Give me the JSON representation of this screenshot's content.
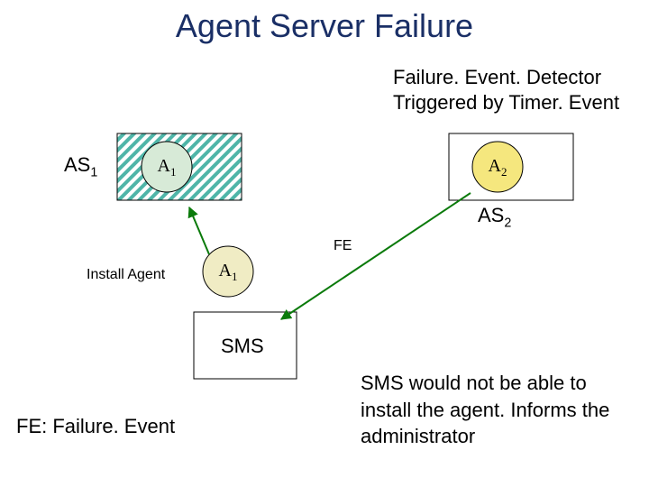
{
  "title": "Agent Server Failure",
  "detector": {
    "line1": "Failure. Event. Detector",
    "line2": "Triggered by Timer. Event"
  },
  "labels": {
    "as1": "AS",
    "as1_sub": "1",
    "as2": "AS",
    "as2_sub": "2",
    "a1": "A",
    "a1_sub": "1",
    "a2": "A",
    "a2_sub": "2",
    "a1_reinstall": "A",
    "a1_reinstall_sub": "1",
    "fe": "FE",
    "install": "Install Agent",
    "sms": "SMS",
    "key": "FE: Failure. Event"
  },
  "sms_note": "SMS would not be able to install the agent. Informs the administrator",
  "colors": {
    "hatch": "#4fb5a8",
    "a1_fill": "#d7ead7",
    "a2_fill": "#f5e77e",
    "a1r_fill": "#f0ecc4",
    "arrow_green": "#0a7a0a"
  }
}
